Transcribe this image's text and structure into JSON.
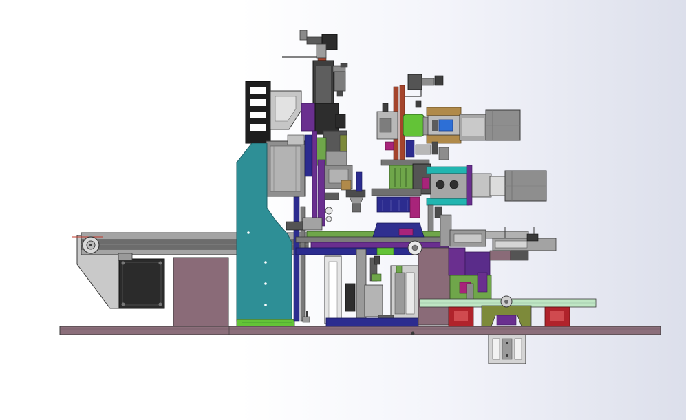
{
  "view": {
    "kind": "cad-assembly-side-view",
    "background": [
      "#ffffff",
      "#dcdfeb"
    ],
    "edge_color": "#3a3a3a"
  },
  "colors": {
    "base_plate": "#8c6f7b",
    "teal_frame": "#2e8f96",
    "pink_block": "#8a6b78",
    "motor_body": "#2b2b2b",
    "motor_gray": "#8e8e8e",
    "rail_gray": "#a4a4a4",
    "rail_dark": "#666666",
    "green_part": "#6fa64a",
    "bright_green": "#63c337",
    "mint_rail": "#bfe6c4",
    "gold_part": "#b08a4a",
    "purple_part": "#6a2f8f",
    "magenta_part": "#a8247a",
    "navy_part": "#2c2c8f",
    "rust_part": "#a4442c",
    "red_block": "#b0232b",
    "cyan_part": "#22b5b0",
    "blue_accent": "#2d6fd6",
    "olive_part": "#7d8a3a"
  },
  "icons": {
    "roller": "pulley-roller-icon",
    "motor": "servo-motor-icon",
    "bolt": "bolt-icon"
  }
}
